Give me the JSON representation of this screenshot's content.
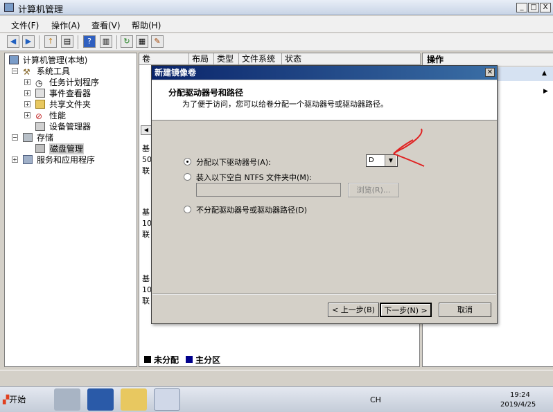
{
  "window": {
    "title": "计算机管理",
    "min": "_",
    "max": "□",
    "close": "X"
  },
  "menu": [
    "文件(F)",
    "操作(A)",
    "查看(V)",
    "帮助(H)"
  ],
  "tree": {
    "root": "计算机管理(本地)",
    "system_tools": "系统工具",
    "task_scheduler": "任务计划程序",
    "event_viewer": "事件查看器",
    "shared_folders": "共享文件夹",
    "performance": "性能",
    "device_manager": "设备管理器",
    "storage": "存储",
    "disk_management": "磁盘管理",
    "services": "服务和应用程序"
  },
  "columns": [
    "卷",
    "布局",
    "类型",
    "文件系统",
    "状态"
  ],
  "disk_fragments": [
    {
      "a": "基",
      "b": "50",
      "c": "联"
    },
    {
      "a": "基",
      "b": "10",
      "c": "联"
    },
    {
      "a": "基",
      "b": "10",
      "c": "联"
    }
  ],
  "legend": {
    "unallocated": "未分配",
    "primary": "主分区"
  },
  "actions": {
    "header": "操作"
  },
  "dialog": {
    "title": "新建镜像卷",
    "heading": "分配驱动器号和路径",
    "subtitle": "为了便于访问，您可以给卷分配一个驱动器号或驱动器路径。",
    "option_assign": "分配以下驱动器号(A):",
    "option_mount": "装入以下空白 NTFS 文件夹中(M):",
    "option_none": "不分配驱动器号或驱动器路径(D)",
    "drive_letter": "D",
    "browse": "浏览(R)...",
    "back": "< 上一步(B)",
    "next": "下一步(N) >",
    "cancel": "取消"
  },
  "taskbar": {
    "start": "开始",
    "lang": "CH",
    "time": "19:24",
    "date": "2019/4/25"
  },
  "colors": {
    "accent": "#0a246a",
    "unallocated": "#000000",
    "primary": "#00008b",
    "annotation": "#e02020"
  }
}
